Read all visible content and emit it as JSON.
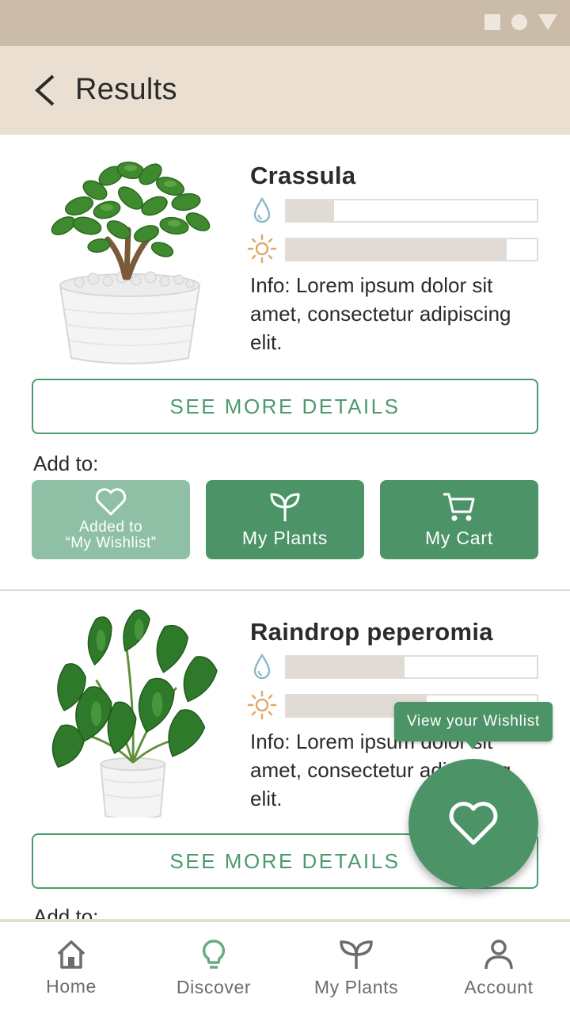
{
  "header": {
    "title": "Results",
    "back_icon": "chevron-left-icon"
  },
  "colors": {
    "primary": "#4c9468",
    "primary_light": "#8fc0a6",
    "header_bg": "#eadfd1",
    "status_bg": "#cbbcaa"
  },
  "plants": [
    {
      "name": "Crassula",
      "water_level": 0.19,
      "sun_level": 0.88,
      "info": "Info: Lorem ipsum dolor sit amet, consectetur adipiscing elit.",
      "details_label": "SEE MORE DETAILS",
      "add_to_label": "Add to:",
      "actions": {
        "wishlist_label": "Added to",
        "wishlist_label_2": "“My Wishlist”",
        "plants_label": "My Plants",
        "cart_label": "My Cart"
      }
    },
    {
      "name": "Raindrop peperomia",
      "water_level": 0.47,
      "sun_level": 0.56,
      "info": "Info: Lorem ipsum dolor sit amet, consectetur adipiscing elit.",
      "details_label": "SEE MORE DETAILS",
      "add_to_label": "Add to:"
    }
  ],
  "wishlist_fab": {
    "tooltip": "View your Wishlist",
    "icon": "heart-icon"
  },
  "bottom_nav": [
    {
      "label": "Home",
      "icon": "home-icon"
    },
    {
      "label": "Discover",
      "icon": "lightbulb-icon",
      "active": true
    },
    {
      "label": "My Plants",
      "icon": "sprout-icon"
    },
    {
      "label": "Account",
      "icon": "person-icon"
    }
  ]
}
